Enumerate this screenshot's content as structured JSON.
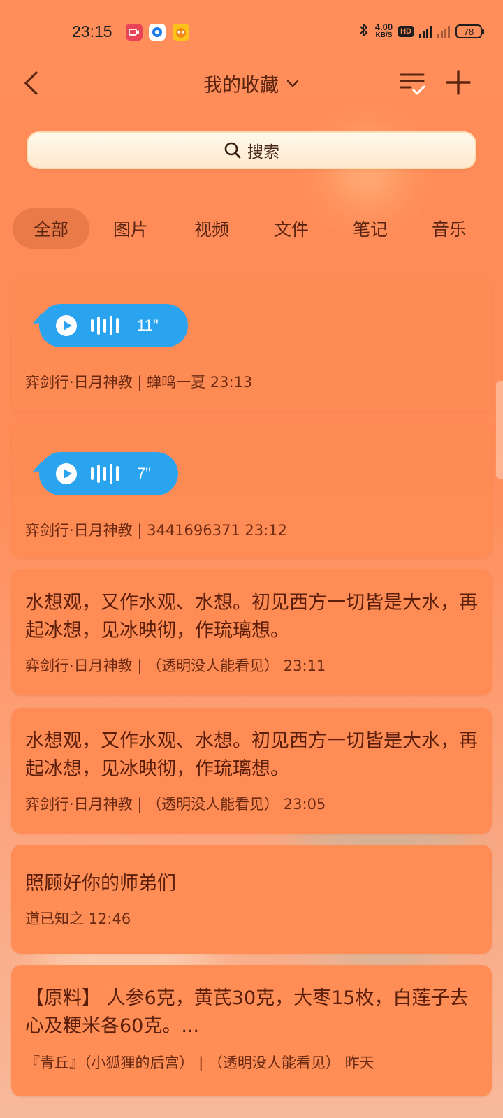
{
  "status_bar": {
    "time": "23:15",
    "net_speed_value": "4.00",
    "net_speed_unit": "KB/S",
    "hd_label": "HD",
    "battery": "78"
  },
  "header": {
    "title": "我的收藏"
  },
  "search": {
    "label": "搜索"
  },
  "tabs": [
    {
      "label": "全部",
      "active": true
    },
    {
      "label": "图片",
      "active": false
    },
    {
      "label": "视频",
      "active": false
    },
    {
      "label": "文件",
      "active": false
    },
    {
      "label": "笔记",
      "active": false
    },
    {
      "label": "音乐",
      "active": false
    }
  ],
  "items": [
    {
      "type": "voice",
      "duration": "11\"",
      "meta": "弈剑行·日月神教 | 蝉鸣一夏  23:13"
    },
    {
      "type": "voice",
      "duration": "7\"",
      "meta": "弈剑行·日月神教 | 3441696371  23:12"
    },
    {
      "type": "text",
      "text": "水想观，又作水观、水想。初见西方一切皆是大水，再起冰想，见冰映彻，作琉璃想。",
      "meta": "弈剑行·日月神教 | （透明没人能看见）  23:11"
    },
    {
      "type": "text",
      "text": "水想观，又作水观、水想。初见西方一切皆是大水，再起冰想，见冰映彻，作琉璃想。",
      "meta": "弈剑行·日月神教 | （透明没人能看见）  23:05"
    },
    {
      "type": "text",
      "text": "照顾好你的师弟们",
      "meta": "道已知之  12:46"
    },
    {
      "type": "text",
      "text": "【原料】 人参6克，黄芪30克，大枣15枚，白莲子去心及粳米各60克。...",
      "meta": "『青丘』（小狐狸的后宫） | （透明没人能看见）  昨天"
    }
  ],
  "colors": {
    "background": "#FF8E5A",
    "card": "#FF8B54",
    "voice_bubble": "#2BA4F0",
    "active_tab": "#CE6438"
  }
}
